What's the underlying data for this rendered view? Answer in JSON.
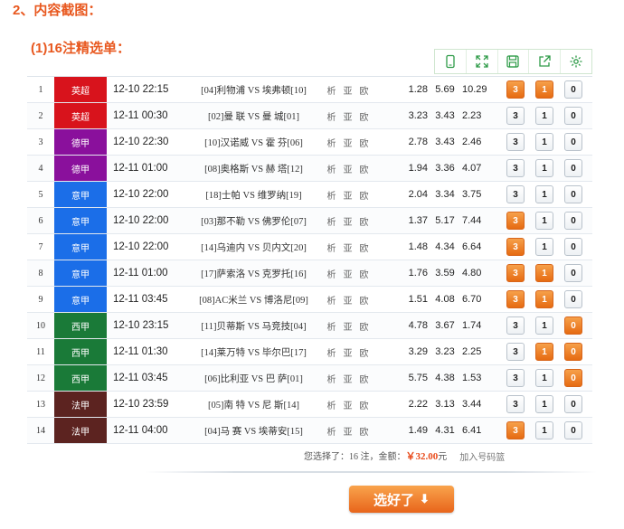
{
  "heading": "2、内容截图：",
  "subheading": "(1)16注精选单：",
  "toolbar": {
    "icons": [
      "phone-icon",
      "fullscreen-icon",
      "save-icon",
      "share-icon",
      "settings-icon"
    ]
  },
  "colors": {
    "yingchao": "#d8131c",
    "dejia": "#8a109c",
    "yijia": "#1b6ee8",
    "xijia": "#1a7a38",
    "fajia": "#5c2320",
    "selected": "#e66b12"
  },
  "matches": [
    {
      "idx": "1",
      "league": "英超",
      "league_color": "#d8131c",
      "time": "12-10 22:15",
      "match": "[04]利物浦 VS 埃弗顿[10]",
      "links": [
        "析",
        "亚",
        "欧"
      ],
      "odds": [
        "1.28",
        "5.69",
        "10.29"
      ],
      "picks": [
        {
          "label": "3",
          "selected": true
        },
        {
          "label": "1",
          "selected": true
        },
        {
          "label": "0",
          "selected": false
        }
      ]
    },
    {
      "idx": "2",
      "league": "英超",
      "league_color": "#d8131c",
      "time": "12-11 00:30",
      "match": "[02]曼 联 VS 曼 城[01]",
      "links": [
        "析",
        "亚",
        "欧"
      ],
      "odds": [
        "3.23",
        "3.43",
        "2.23"
      ],
      "picks": [
        {
          "label": "3",
          "selected": false
        },
        {
          "label": "1",
          "selected": false
        },
        {
          "label": "0",
          "selected": false
        }
      ]
    },
    {
      "idx": "3",
      "league": "德甲",
      "league_color": "#8a109c",
      "time": "12-10 22:30",
      "match": "[10]汉诺威 VS 霍 芬[06]",
      "links": [
        "析",
        "亚",
        "欧"
      ],
      "odds": [
        "2.78",
        "3.43",
        "2.46"
      ],
      "picks": [
        {
          "label": "3",
          "selected": false
        },
        {
          "label": "1",
          "selected": false
        },
        {
          "label": "0",
          "selected": false
        }
      ]
    },
    {
      "idx": "4",
      "league": "德甲",
      "league_color": "#8a109c",
      "time": "12-11 01:00",
      "match": "[08]奥格斯 VS 赫 塔[12]",
      "links": [
        "析",
        "亚",
        "欧"
      ],
      "odds": [
        "1.94",
        "3.36",
        "4.07"
      ],
      "picks": [
        {
          "label": "3",
          "selected": false
        },
        {
          "label": "1",
          "selected": false
        },
        {
          "label": "0",
          "selected": false
        }
      ]
    },
    {
      "idx": "5",
      "league": "意甲",
      "league_color": "#1b6ee8",
      "time": "12-10 22:00",
      "match": "[18]士帕 VS 维罗纳[19]",
      "links": [
        "析",
        "亚",
        "欧"
      ],
      "odds": [
        "2.04",
        "3.34",
        "3.75"
      ],
      "picks": [
        {
          "label": "3",
          "selected": false
        },
        {
          "label": "1",
          "selected": false
        },
        {
          "label": "0",
          "selected": false
        }
      ]
    },
    {
      "idx": "6",
      "league": "意甲",
      "league_color": "#1b6ee8",
      "time": "12-10 22:00",
      "match": "[03]那不勒 VS 佛罗伦[07]",
      "links": [
        "析",
        "亚",
        "欧"
      ],
      "odds": [
        "1.37",
        "5.17",
        "7.44"
      ],
      "picks": [
        {
          "label": "3",
          "selected": true
        },
        {
          "label": "1",
          "selected": false
        },
        {
          "label": "0",
          "selected": false
        }
      ]
    },
    {
      "idx": "7",
      "league": "意甲",
      "league_color": "#1b6ee8",
      "time": "12-10 22:00",
      "match": "[14]乌迪内 VS 贝内文[20]",
      "links": [
        "析",
        "亚",
        "欧"
      ],
      "odds": [
        "1.48",
        "4.34",
        "6.64"
      ],
      "picks": [
        {
          "label": "3",
          "selected": true
        },
        {
          "label": "1",
          "selected": false
        },
        {
          "label": "0",
          "selected": false
        }
      ]
    },
    {
      "idx": "8",
      "league": "意甲",
      "league_color": "#1b6ee8",
      "time": "12-11 01:00",
      "match": "[17]萨索洛 VS 克罗托[16]",
      "links": [
        "析",
        "亚",
        "欧"
      ],
      "odds": [
        "1.76",
        "3.59",
        "4.80"
      ],
      "picks": [
        {
          "label": "3",
          "selected": true
        },
        {
          "label": "1",
          "selected": true
        },
        {
          "label": "0",
          "selected": false
        }
      ]
    },
    {
      "idx": "9",
      "league": "意甲",
      "league_color": "#1b6ee8",
      "time": "12-11 03:45",
      "match": "[08]AC米兰 VS 博洛尼[09]",
      "links": [
        "析",
        "亚",
        "欧"
      ],
      "odds": [
        "1.51",
        "4.08",
        "6.70"
      ],
      "picks": [
        {
          "label": "3",
          "selected": true
        },
        {
          "label": "1",
          "selected": true
        },
        {
          "label": "0",
          "selected": false
        }
      ]
    },
    {
      "idx": "10",
      "league": "西甲",
      "league_color": "#1a7a38",
      "time": "12-10 23:15",
      "match": "[11]贝蒂斯 VS 马竞技[04]",
      "links": [
        "析",
        "亚",
        "欧"
      ],
      "odds": [
        "4.78",
        "3.67",
        "1.74"
      ],
      "picks": [
        {
          "label": "3",
          "selected": false
        },
        {
          "label": "1",
          "selected": false
        },
        {
          "label": "0",
          "selected": true
        }
      ]
    },
    {
      "idx": "11",
      "league": "西甲",
      "league_color": "#1a7a38",
      "time": "12-11 01:30",
      "match": "[14]莱万特 VS 毕尔巴[17]",
      "links": [
        "析",
        "亚",
        "欧"
      ],
      "odds": [
        "3.29",
        "3.23",
        "2.25"
      ],
      "picks": [
        {
          "label": "3",
          "selected": false
        },
        {
          "label": "1",
          "selected": true
        },
        {
          "label": "0",
          "selected": true
        }
      ]
    },
    {
      "idx": "12",
      "league": "西甲",
      "league_color": "#1a7a38",
      "time": "12-11 03:45",
      "match": "[06]比利亚 VS 巴 萨[01]",
      "links": [
        "析",
        "亚",
        "欧"
      ],
      "odds": [
        "5.75",
        "4.38",
        "1.53"
      ],
      "picks": [
        {
          "label": "3",
          "selected": false
        },
        {
          "label": "1",
          "selected": false
        },
        {
          "label": "0",
          "selected": true
        }
      ]
    },
    {
      "idx": "13",
      "league": "法甲",
      "league_color": "#5c2320",
      "time": "12-10 23:59",
      "match": "[05]南 特 VS 尼 斯[14]",
      "links": [
        "析",
        "亚",
        "欧"
      ],
      "odds": [
        "2.22",
        "3.13",
        "3.44"
      ],
      "picks": [
        {
          "label": "3",
          "selected": false
        },
        {
          "label": "1",
          "selected": false
        },
        {
          "label": "0",
          "selected": false
        }
      ]
    },
    {
      "idx": "14",
      "league": "法甲",
      "league_color": "#5c2320",
      "time": "12-11 04:00",
      "match": "[04]马 赛 VS 埃蒂安[15]",
      "links": [
        "析",
        "亚",
        "欧"
      ],
      "odds": [
        "1.49",
        "4.31",
        "6.41"
      ],
      "picks": [
        {
          "label": "3",
          "selected": true
        },
        {
          "label": "1",
          "selected": false
        },
        {
          "label": "0",
          "selected": false
        }
      ]
    }
  ],
  "footer": {
    "selected_prefix": "您选择了：",
    "count": "16",
    "count_suffix": " 注，金额：",
    "amount": "￥32.00",
    "amount_suffix": "元",
    "add_link": "加入号码篮"
  },
  "done_button": {
    "label": "选好了",
    "arrow": "🡇"
  }
}
